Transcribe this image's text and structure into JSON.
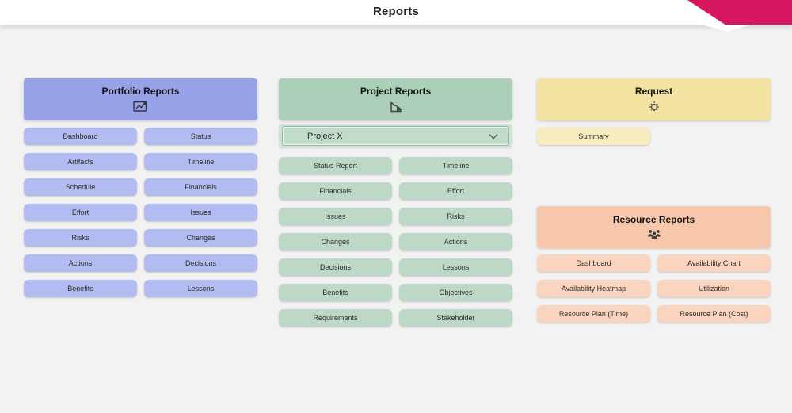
{
  "header": {
    "title": "Reports"
  },
  "colors": {
    "accent_pink": "#d6175f",
    "page_background": "#f2f2f2",
    "portfolio_header": "#97a1e8",
    "portfolio_button": "#b3bcf1",
    "project_header": "#accfb9",
    "project_button": "#bdd8c6",
    "request_header": "#f3e3a3",
    "request_button": "#f6ecbd",
    "resource_header": "#f7c7ab",
    "resource_button": "#f9d5c0"
  },
  "panels": {
    "portfolio": {
      "title": "Portfolio Reports",
      "icon": "line-chart-icon",
      "buttons": [
        "Dashboard",
        "Status",
        "Artifacts",
        "Timeline",
        "Schedule",
        "Financials",
        "Effort",
        "Issues",
        "Risks",
        "Changes",
        "Actions",
        "Decisions",
        "Benefits",
        "Lessons"
      ]
    },
    "project": {
      "title": "Project Reports",
      "icon": "burndown-chart-icon",
      "dropdown": {
        "value": "Project X",
        "icon": "chevron-down-icon"
      },
      "buttons": [
        "Status Report",
        "Timeline",
        "Financials",
        "Effort",
        "Issues",
        "Risks",
        "Changes",
        "Actions",
        "Decisions",
        "Lessons",
        "Benefits",
        "Objectives",
        "Requirements",
        "Stakeholder"
      ]
    },
    "request": {
      "title": "Request",
      "icon": "lightbulb-icon",
      "buttons": [
        "Summary"
      ]
    },
    "resource": {
      "title": "Resource Reports",
      "icon": "people-group-icon",
      "buttons": [
        "Dashboard",
        "Availability Chart",
        "Availability Heatmap",
        "Utilization",
        "Resource Plan (Time)",
        "Resource Plan (Cost)"
      ]
    }
  }
}
